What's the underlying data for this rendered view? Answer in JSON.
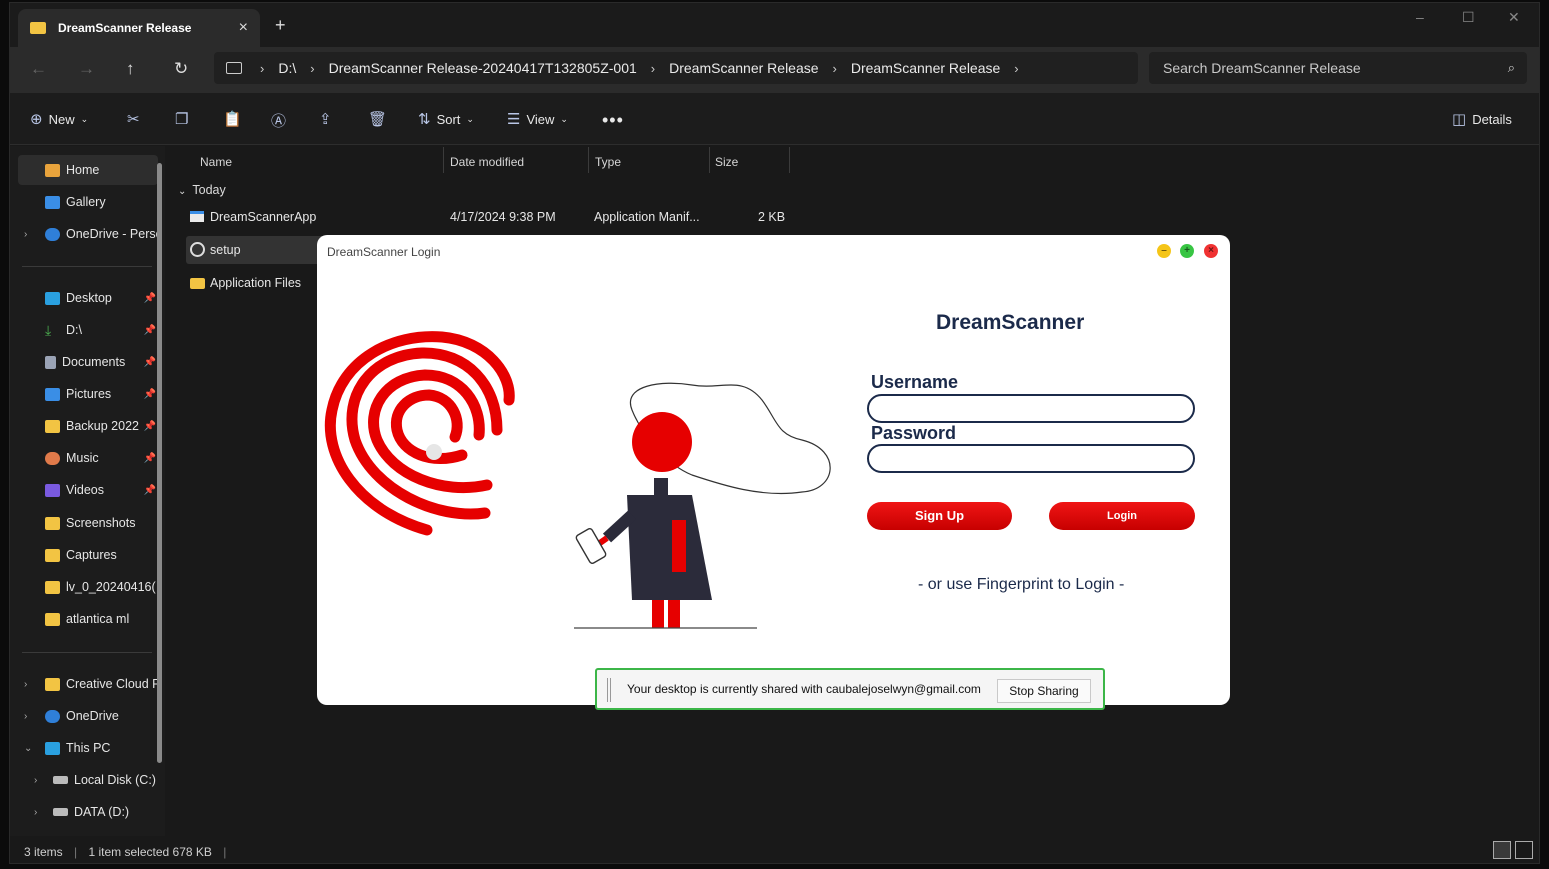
{
  "tab": {
    "title": "DreamScanner Release"
  },
  "address": {
    "crumbs": [
      "D:\\",
      "DreamScanner Release-20240417T132805Z-001",
      "DreamScanner Release",
      "DreamScanner Release"
    ]
  },
  "search": {
    "placeholder": "Search DreamScanner Release"
  },
  "commands": {
    "new": "New",
    "sort": "Sort",
    "view": "View",
    "details": "Details"
  },
  "sidebar": {
    "items": [
      {
        "label": "Home",
        "color": "#e8a33c"
      },
      {
        "label": "Gallery",
        "color": "#3a8ee6"
      },
      {
        "label": "OneDrive - Perso",
        "color": "#2f7fd8"
      },
      {
        "label": "Desktop",
        "color": "#2aa0e0"
      },
      {
        "label": "D:\\",
        "color": "#4caf50"
      },
      {
        "label": "Documents",
        "color": "#9aa3b5"
      },
      {
        "label": "Pictures",
        "color": "#3a8ee6"
      },
      {
        "label": "Backup 2022",
        "color": "#f2c443"
      },
      {
        "label": "Music",
        "color": "#e07a4a"
      },
      {
        "label": "Videos",
        "color": "#7a5ae0"
      },
      {
        "label": "Screenshots",
        "color": "#f2c443"
      },
      {
        "label": "Captures",
        "color": "#f2c443"
      },
      {
        "label": "lv_0_20240416(",
        "color": "#f2c443"
      },
      {
        "label": "atlantica ml",
        "color": "#f2c443"
      },
      {
        "label": "Creative Cloud F",
        "color": "#f2c443"
      },
      {
        "label": "OneDrive",
        "color": "#2f7fd8"
      },
      {
        "label": "This PC",
        "color": "#2aa0e0"
      },
      {
        "label": "Local Disk (C:)",
        "color": "#bbbbbb"
      },
      {
        "label": "DATA (D:)",
        "color": "#bbbbbb"
      }
    ]
  },
  "columns": {
    "name": "Name",
    "date": "Date modified",
    "type": "Type",
    "size": "Size"
  },
  "group": "Today",
  "files": [
    {
      "name": "DreamScannerApp",
      "date": "4/17/2024 9:38 PM",
      "type": "Application Manif...",
      "size": "2 KB"
    },
    {
      "name": "setup",
      "date": "",
      "type": "",
      "size": ""
    },
    {
      "name": "Application Files",
      "date": "",
      "type": "",
      "size": ""
    }
  ],
  "status": {
    "count": "3 items",
    "selected": "1 item selected  678 KB"
  },
  "dialog": {
    "title": "DreamScanner Login",
    "app_name": "DreamScanner",
    "username_label": "Username",
    "password_label": "Password",
    "signup": "Sign Up",
    "login": "Login",
    "fingerprint_hint": "- or use Fingerprint to Login -"
  },
  "share": {
    "message": "Your desktop is currently shared with caubalejoselwyn@gmail.com",
    "stop": "Stop Sharing"
  },
  "colors": {
    "accent_red": "#e60000",
    "navy": "#1b2a4a",
    "share_green": "#3cb648"
  }
}
